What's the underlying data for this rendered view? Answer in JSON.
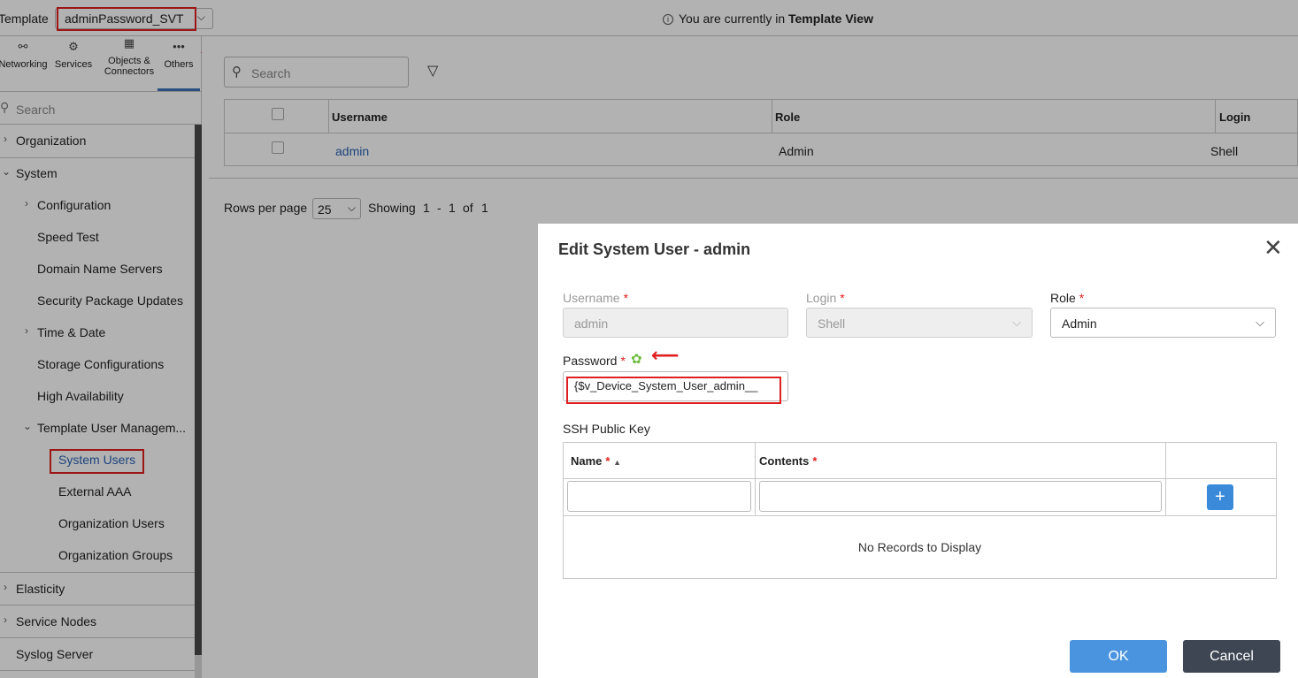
{
  "topbar": {
    "template_label": "Template",
    "template_value": "adminPassword_SVT",
    "view_prefix": "You are currently in",
    "view_name": "Template View"
  },
  "nav_tabs": [
    {
      "label": "Networking",
      "icon": "networking-icon"
    },
    {
      "label": "Services",
      "icon": "gears-icon"
    },
    {
      "label": "Objects & Connectors",
      "icon": "grid-icon"
    },
    {
      "label": "Others",
      "icon": "more-icon"
    }
  ],
  "nav_search_placeholder": "Search",
  "tree": {
    "organization": "Organization",
    "system": "System",
    "configuration": "Configuration",
    "speed_test": "Speed Test",
    "dns": "Domain Name Servers",
    "security_pkg": "Security Package Updates",
    "time_date": "Time & Date",
    "storage": "Storage Configurations",
    "ha": "High Availability",
    "template_user_mgmt": "Template User Managem...",
    "system_users": "System Users",
    "external_aaa": "External AAA",
    "org_users": "Organization Users",
    "org_groups": "Organization Groups",
    "elasticity": "Elasticity",
    "service_nodes": "Service Nodes",
    "syslog": "Syslog Server"
  },
  "main": {
    "search_placeholder": "Search",
    "columns": [
      "Username",
      "Role",
      "Login"
    ],
    "rows": [
      {
        "username": "admin",
        "role": "Admin",
        "login": "Shell"
      }
    ],
    "pager": {
      "rows_per_page_label": "Rows per page",
      "rows_per_page": "25",
      "showing_label": "Showing",
      "from": "1",
      "dash": "-",
      "to": "1",
      "of_label": "of",
      "total": "1"
    }
  },
  "dialog": {
    "title": "Edit System User - admin",
    "username_label": "Username",
    "username_value": "admin",
    "login_label": "Login",
    "login_value": "Shell",
    "role_label": "Role",
    "role_value": "Admin",
    "password_label": "Password",
    "password_value": "{$v_Device_System_User_admin__",
    "ssh_label": "SSH Public Key",
    "ssh_columns": {
      "name": "Name",
      "contents": "Contents"
    },
    "no_records": "No Records to Display",
    "add_label": "+",
    "ok_label": "OK",
    "cancel_label": "Cancel"
  },
  "colors": {
    "accent": "#3b73b9",
    "link": "#2a62b3",
    "ok_button": "#4a94df",
    "cancel_button": "#3e4553",
    "highlight": "#e02020",
    "gear": "#6dbb3c"
  }
}
